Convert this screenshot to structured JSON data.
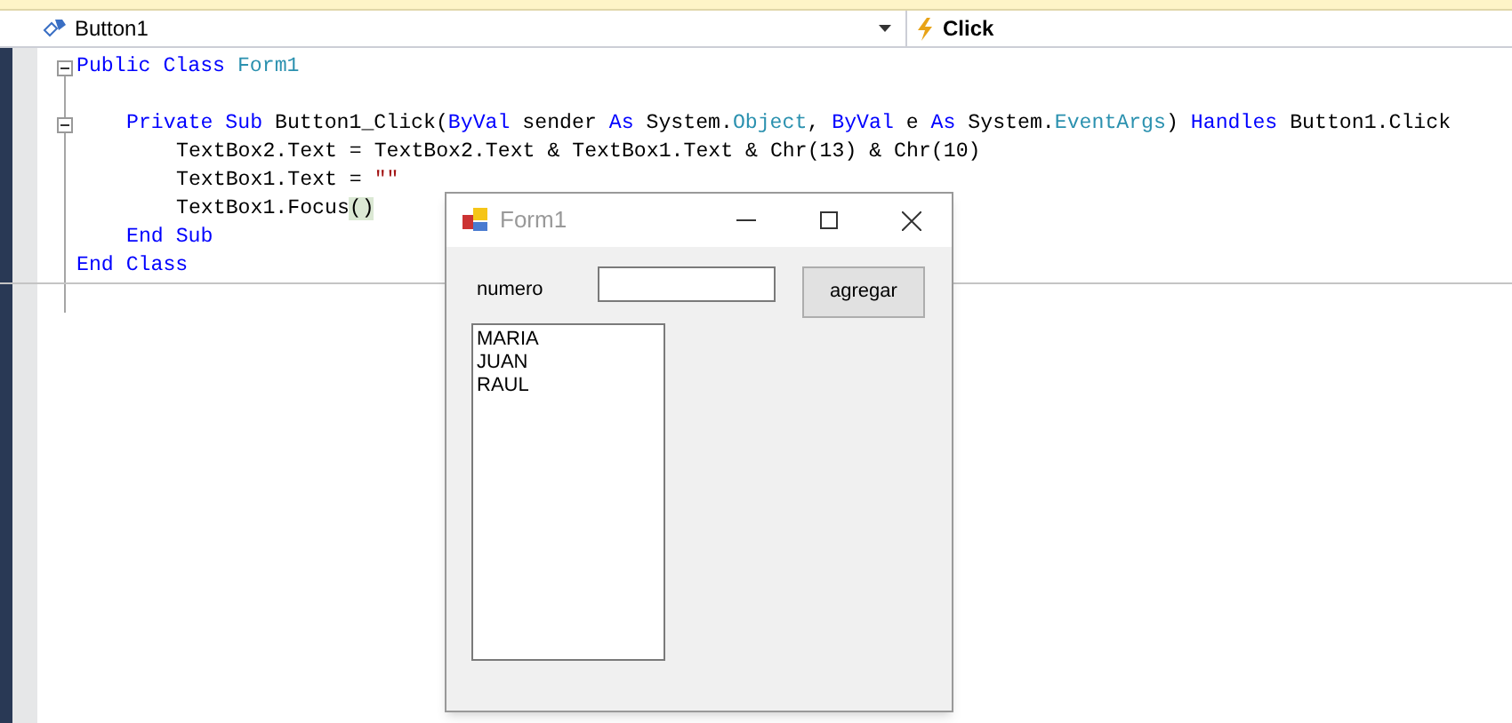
{
  "navigation_bar": {
    "object_dropdown": "Button1",
    "event_dropdown": "Click"
  },
  "code": [
    {
      "collapsible": true,
      "tokens": [
        {
          "kind": "keyword",
          "text": "Public Class "
        },
        {
          "kind": "type",
          "text": "Form1"
        }
      ],
      "children": [
        {
          "collapsible": true,
          "tokens": [
            {
              "kind": "keyword",
              "text": "Private Sub "
            },
            {
              "kind": "plain",
              "text": "Button1_Click("
            },
            {
              "kind": "keyword",
              "text": "ByVal "
            },
            {
              "kind": "plain",
              "text": "sender "
            },
            {
              "kind": "keyword",
              "text": "As "
            },
            {
              "kind": "plain",
              "text": "System."
            },
            {
              "kind": "type",
              "text": "Object"
            },
            {
              "kind": "plain",
              "text": ", "
            },
            {
              "kind": "keyword",
              "text": "ByVal "
            },
            {
              "kind": "plain",
              "text": "e "
            },
            {
              "kind": "keyword",
              "text": "As "
            },
            {
              "kind": "plain",
              "text": "System."
            },
            {
              "kind": "type",
              "text": "EventArgs"
            },
            {
              "kind": "plain",
              "text": ") "
            },
            {
              "kind": "keyword",
              "text": "Handles "
            },
            {
              "kind": "plain",
              "text": "Button1.Click"
            }
          ],
          "children": [
            {
              "tokens": [
                {
                  "kind": "plain",
                  "text": "TextBox2.Text = TextBox2.Text & TextBox1.Text & Chr(13) & Chr(10)"
                }
              ]
            },
            {
              "tokens": [
                {
                  "kind": "plain",
                  "text": "TextBox1.Text = "
                },
                {
                  "kind": "string",
                  "text": "\"\""
                }
              ]
            },
            {
              "tokens": [
                {
                  "kind": "plain",
                  "text": "TextBox1.Focus"
                },
                {
                  "kind": "highlight",
                  "text": "()"
                }
              ]
            }
          ]
        },
        {
          "tokens": [
            {
              "kind": "keyword",
              "text": "End Sub"
            }
          ]
        }
      ]
    },
    {
      "tokens": [
        {
          "kind": "keyword",
          "text": "End Class"
        }
      ]
    }
  ],
  "form_window": {
    "title": "Form1",
    "label": "numero",
    "button": "agregar",
    "list_lines": [
      "MARIA",
      "JUAN",
      "RAUL"
    ]
  }
}
